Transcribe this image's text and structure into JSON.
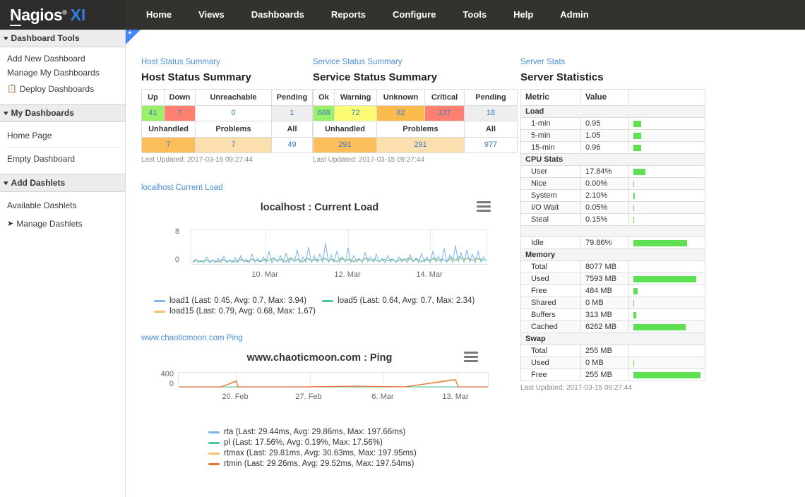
{
  "brand": {
    "name_plain": "Nagios",
    "name_prefix": "N",
    "name_rest": "agios",
    "registered": "®",
    "product": "XI",
    "accent_blue": "#2f7fe0",
    "nav_bg": "#34322f"
  },
  "topnav": {
    "items": [
      {
        "label": "Home"
      },
      {
        "label": "Views"
      },
      {
        "label": "Dashboards"
      },
      {
        "label": "Reports"
      },
      {
        "label": "Configure"
      },
      {
        "label": "Tools"
      },
      {
        "label": "Help"
      },
      {
        "label": "Admin"
      }
    ]
  },
  "sidebar": {
    "sections": [
      {
        "title": "Dashboard Tools",
        "links": [
          {
            "label": "Add New Dashboard",
            "icon": ""
          },
          {
            "label": "Manage My Dashboards",
            "icon": ""
          },
          {
            "label": "Deploy Dashboards",
            "icon": "copy-icon",
            "glyph": "❐"
          }
        ]
      },
      {
        "title": "My Dashboards",
        "links": [
          {
            "label": "Home Page",
            "icon": ""
          },
          {
            "label": "Empty Dashboard",
            "icon": ""
          }
        ]
      },
      {
        "title": "Add Dashlets",
        "links": [
          {
            "label": "Available Dashlets",
            "icon": ""
          },
          {
            "label": "Manage Dashlets",
            "icon": "share-arrow-icon",
            "glyph": "➜"
          }
        ]
      }
    ]
  },
  "plus_tab": {
    "glyph": "+"
  },
  "host_status": {
    "link": "Host Status Summary",
    "title": "Host Status Summary",
    "headers_row1": [
      "Up",
      "Down",
      "Unreachable",
      "Pending"
    ],
    "values_row1": [
      "41",
      "7",
      "0",
      "1"
    ],
    "headers_row2": [
      "Unhandled",
      "Problems",
      "All"
    ],
    "values_row2": [
      "7",
      "7",
      "49"
    ],
    "last_updated": "Last Updated: 2017-03-15 09:27:44"
  },
  "service_status": {
    "link": "Service Status Summary",
    "title": "Service Status Summary",
    "headers_row1": [
      "Ok",
      "Warning",
      "Unknown",
      "Critical",
      "Pending"
    ],
    "values_row1": [
      "668",
      "72",
      "82",
      "137",
      "18"
    ],
    "headers_row2": [
      "Unhandled",
      "Problems",
      "All"
    ],
    "values_row2": [
      "291",
      "291",
      "977"
    ],
    "last_updated": "Last Updated: 2017-03-15 09:27:44"
  },
  "server_stats": {
    "link": "Server Stats",
    "title": "Server Statistics",
    "headers": [
      "Metric",
      "Value",
      ""
    ],
    "last_updated": "Last Updated: 2017-03-15 09:27:44",
    "rows": [
      {
        "type": "group",
        "metric": "Load"
      },
      {
        "type": "data",
        "metric": "1-min",
        "value": "0.95",
        "bar_pct": 12
      },
      {
        "type": "data",
        "metric": "5-min",
        "value": "1.05",
        "bar_pct": 12
      },
      {
        "type": "data",
        "metric": "15-min",
        "value": "0.96",
        "bar_pct": 12
      },
      {
        "type": "group",
        "metric": "CPU Stats"
      },
      {
        "type": "data",
        "metric": "User",
        "value": "17.84%",
        "bar_pct": 18
      },
      {
        "type": "data",
        "metric": "Nice",
        "value": "0.00%",
        "bar_pct": 1
      },
      {
        "type": "data",
        "metric": "System",
        "value": "2.10%",
        "bar_pct": 2
      },
      {
        "type": "data",
        "metric": "I/O Wait",
        "value": "0.05%",
        "bar_pct": 1
      },
      {
        "type": "data",
        "metric": "Steal",
        "value": "0.15%",
        "bar_pct": 1
      },
      {
        "type": "group",
        "metric": ""
      },
      {
        "type": "data",
        "metric": "Idle",
        "value": "79.86%",
        "bar_pct": 80
      },
      {
        "type": "group",
        "metric": "Memory"
      },
      {
        "type": "data",
        "metric": "Total",
        "value": "8077 MB",
        "bar_pct": 0
      },
      {
        "type": "data",
        "metric": "Used",
        "value": "7593 MB",
        "bar_pct": 94
      },
      {
        "type": "data",
        "metric": "Free",
        "value": "484 MB",
        "bar_pct": 6
      },
      {
        "type": "data",
        "metric": "Shared",
        "value": "0 MB",
        "bar_pct": 1
      },
      {
        "type": "data",
        "metric": "Buffers",
        "value": "313 MB",
        "bar_pct": 4
      },
      {
        "type": "data",
        "metric": "Cached",
        "value": "6262 MB",
        "bar_pct": 78
      },
      {
        "type": "group",
        "metric": "Swap"
      },
      {
        "type": "data",
        "metric": "Total",
        "value": "255 MB",
        "bar_pct": 0
      },
      {
        "type": "data",
        "metric": "Used",
        "value": "0 MB",
        "bar_pct": 1
      },
      {
        "type": "data",
        "metric": "Free",
        "value": "255 MB",
        "bar_pct": 100
      }
    ]
  },
  "chart_data": [
    {
      "type": "line",
      "dashlet_link": "localhost Current Load",
      "title": "localhost : Current Load",
      "xlabel": "",
      "ylabel": "",
      "ylim": [
        0,
        8
      ],
      "yticks": [
        "0",
        "8"
      ],
      "xticks": [
        "10. Mar",
        "12. Mar",
        "14. Mar"
      ],
      "grid": true,
      "legend_position": "bottom",
      "menu_icon": "hamburger-icon",
      "series": [
        {
          "name": "load1",
          "label": "load1 (Last: 0.45, Avg: 0.7, Max: 3.94)",
          "color": "#7cb5ec",
          "last": 0.45,
          "avg": 0.7,
          "max": 3.94
        },
        {
          "name": "load5",
          "label": "load5 (Last: 0.64, Avg: 0.7, Max: 2.34)",
          "color": "#4ec49a",
          "last": 0.64,
          "avg": 0.7,
          "max": 2.34
        },
        {
          "name": "load15",
          "label": "load15 (Last: 0.79, Avg: 0.68, Max: 1.67)",
          "color": "#f5c165",
          "last": 0.79,
          "avg": 0.68,
          "max": 1.67
        }
      ]
    },
    {
      "type": "line",
      "dashlet_link": "www.chaoticmoon.com Ping",
      "title": "www.chaoticmoon.com : Ping",
      "xlabel": "",
      "ylabel": "",
      "ylim": [
        0,
        400
      ],
      "yticks": [
        "0",
        "400"
      ],
      "xticks": [
        "20. Feb",
        "27. Feb",
        "6. Mar",
        "13. Mar"
      ],
      "grid": true,
      "legend_position": "bottom",
      "menu_icon": "hamburger-icon",
      "series": [
        {
          "name": "rta",
          "label": "rta (Last: 29.44ms, Avg: 29.86ms, Max: 197.66ms)",
          "color": "#7cb5ec",
          "last": 29.44,
          "avg": 29.86,
          "max": 197.66
        },
        {
          "name": "pl",
          "label": "pl (Last: 17.56%, Avg: 0.19%, Max: 17.56%)",
          "color": "#4ec49a",
          "last": 17.56,
          "avg": 0.19,
          "max": 17.56
        },
        {
          "name": "rtmax",
          "label": "rtmax (Last: 29.81ms, Avg: 30.63ms, Max: 197.95ms)",
          "color": "#f5c165",
          "last": 29.81,
          "avg": 30.63,
          "max": 197.95
        },
        {
          "name": "rtmin",
          "label": "rtmin (Last: 29.26ms, Avg: 29.52ms, Max: 197.54ms)",
          "color": "#e8713c",
          "last": 29.26,
          "avg": 29.52,
          "max": 197.54
        }
      ]
    }
  ]
}
